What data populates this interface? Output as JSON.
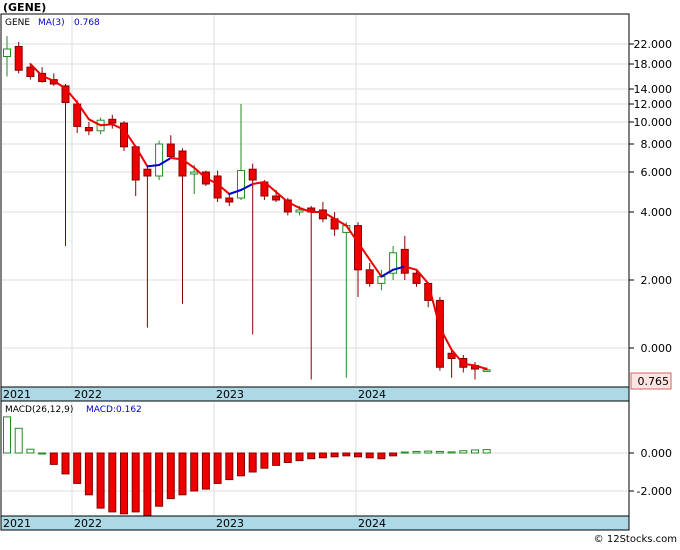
{
  "title": "(GENE)",
  "watermark": "© 12Stocks.com",
  "colors": {
    "up_fill": "#ffffff",
    "up_stroke": "#228b22",
    "down_fill": "#ee0000",
    "down_stroke": "#880000",
    "ma_down": "#ee0000",
    "ma_up": "#0000cc",
    "axis_band": "#add8e6",
    "last_price_box": "#ffe4e1",
    "macd_up": "#228b22",
    "macd_down": "#ee0000"
  },
  "chart_data": [
    {
      "type": "candlestick",
      "legend": {
        "symbol": "GENE",
        "ma_label": "MA(3)",
        "ma_value": "0.768"
      },
      "y_tick_labels": [
        "22.000",
        "18.000",
        "14.000",
        "12.000",
        "10.000",
        "8.000",
        "6.000",
        "4.000",
        "2.000",
        "0.000"
      ],
      "x_tick_labels": [
        "2021",
        "2022",
        "2023",
        "2024"
      ],
      "last_price_label": "0.765",
      "candles": [
        {
          "o": 19.5,
          "h": 24.0,
          "l": 16.0,
          "c": 21.0
        },
        {
          "o": 21.5,
          "h": 22.5,
          "l": 16.5,
          "c": 17.0
        },
        {
          "o": 17.5,
          "h": 18.0,
          "l": 15.5,
          "c": 16.0
        },
        {
          "o": 16.5,
          "h": 17.5,
          "l": 15.0,
          "c": 15.2
        },
        {
          "o": 15.5,
          "h": 16.5,
          "l": 14.5,
          "c": 14.8
        },
        {
          "o": 14.5,
          "h": 14.8,
          "l": 3.0,
          "c": 12.2
        },
        {
          "o": 12.0,
          "h": 12.5,
          "l": 9.0,
          "c": 9.6
        },
        {
          "o": 9.5,
          "h": 10.0,
          "l": 8.8,
          "c": 9.2
        },
        {
          "o": 9.2,
          "h": 10.5,
          "l": 8.9,
          "c": 10.2
        },
        {
          "o": 10.3,
          "h": 10.8,
          "l": 9.4,
          "c": 9.9
        },
        {
          "o": 9.9,
          "h": 10.1,
          "l": 7.5,
          "c": 7.8
        },
        {
          "o": 7.8,
          "h": 7.9,
          "l": 4.8,
          "c": 5.6
        },
        {
          "o": 6.2,
          "h": 6.5,
          "l": 0.6,
          "c": 5.8
        },
        {
          "o": 5.8,
          "h": 8.3,
          "l": 5.6,
          "c": 8.0
        },
        {
          "o": 8.0,
          "h": 8.8,
          "l": 7.0,
          "c": 7.1
        },
        {
          "o": 7.5,
          "h": 7.7,
          "l": 1.3,
          "c": 5.8
        },
        {
          "o": 5.9,
          "h": 6.5,
          "l": 4.9,
          "c": 6.0
        },
        {
          "o": 6.0,
          "h": 6.1,
          "l": 5.3,
          "c": 5.4
        },
        {
          "o": 5.8,
          "h": 6.1,
          "l": 4.5,
          "c": 4.7
        },
        {
          "o": 4.7,
          "h": 4.9,
          "l": 4.3,
          "c": 4.5
        },
        {
          "o": 4.7,
          "h": 12.0,
          "l": 4.6,
          "c": 6.1
        },
        {
          "o": 6.2,
          "h": 6.6,
          "l": 0.4,
          "c": 5.6
        },
        {
          "o": 5.5,
          "h": 5.6,
          "l": 4.6,
          "c": 4.8
        },
        {
          "o": 4.8,
          "h": 5.1,
          "l": 4.5,
          "c": 4.6
        },
        {
          "o": 4.6,
          "h": 4.7,
          "l": 3.9,
          "c": 4.0
        },
        {
          "o": 4.0,
          "h": 4.3,
          "l": 3.9,
          "c": 4.1
        },
        {
          "o": 4.2,
          "h": 4.3,
          "l": -1.8,
          "c": 4.0
        },
        {
          "o": 4.1,
          "h": 4.5,
          "l": 3.7,
          "c": 3.8
        },
        {
          "o": 3.8,
          "h": 4.0,
          "l": 3.3,
          "c": 3.5
        },
        {
          "o": 3.4,
          "h": 3.7,
          "l": -1.7,
          "c": 3.6
        },
        {
          "o": 3.6,
          "h": 3.7,
          "l": 1.5,
          "c": 2.3
        },
        {
          "o": 2.3,
          "h": 2.5,
          "l": 1.8,
          "c": 1.9
        },
        {
          "o": 1.9,
          "h": 2.3,
          "l": 1.7,
          "c": 2.1
        },
        {
          "o": 2.2,
          "h": 3.0,
          "l": 2.0,
          "c": 2.8
        },
        {
          "o": 2.9,
          "h": 3.3,
          "l": 2.0,
          "c": 2.2
        },
        {
          "o": 2.2,
          "h": 2.3,
          "l": 1.8,
          "c": 1.9
        },
        {
          "o": 1.9,
          "h": 1.9,
          "l": 1.2,
          "c": 1.4
        },
        {
          "o": 1.4,
          "h": 1.5,
          "l": -1.3,
          "c": -1.1
        },
        {
          "o": -0.3,
          "h": -0.1,
          "l": -1.7,
          "c": -0.6
        },
        {
          "o": -0.6,
          "h": -0.4,
          "l": -1.4,
          "c": -1.1
        },
        {
          "o": -1.0,
          "h": -0.8,
          "l": -1.8,
          "c": -1.2
        },
        {
          "o": -1.25,
          "h": -1.1,
          "l": -1.35,
          "c": -1.25
        }
      ],
      "ma": [
        null,
        null,
        18.0,
        16.1,
        15.3,
        14.1,
        12.2,
        10.3,
        9.7,
        9.8,
        9.3,
        7.8,
        6.4,
        6.5,
        7.0,
        6.9,
        6.3,
        5.7,
        5.4,
        4.9,
        5.1,
        5.4,
        5.5,
        5.0,
        4.5,
        4.2,
        4.0,
        4.0,
        3.8,
        3.6,
        3.1,
        2.6,
        2.1,
        2.3,
        2.4,
        2.3,
        1.9,
        0.6,
        -0.1,
        -0.9,
        -1.0,
        -1.2
      ],
      "ma_up": [
        false,
        false,
        false,
        false,
        false,
        false,
        false,
        false,
        false,
        false,
        false,
        false,
        false,
        true,
        true,
        false,
        false,
        false,
        false,
        false,
        true,
        true,
        false,
        false,
        false,
        false,
        false,
        false,
        false,
        false,
        false,
        false,
        false,
        true,
        true,
        false,
        false,
        false,
        false,
        false,
        false,
        false
      ]
    },
    {
      "type": "bar",
      "legend": {
        "label": "MACD(26,12,9)",
        "value_label": "MACD:0.162"
      },
      "y_tick_labels": [
        "0.000",
        "-2.000"
      ],
      "x_tick_labels": [
        "2021",
        "2022",
        "2023",
        "2024"
      ],
      "histogram": [
        1.9,
        1.3,
        0.2,
        0,
        -0.6,
        -1.1,
        -1.6,
        -2.2,
        -2.9,
        -3.1,
        -3.2,
        -3.1,
        -3.3,
        -2.8,
        -2.4,
        -2.2,
        -2.0,
        -1.9,
        -1.6,
        -1.4,
        -1.2,
        -1.0,
        -0.8,
        -0.65,
        -0.5,
        -0.4,
        -0.3,
        -0.25,
        -0.2,
        -0.15,
        -0.2,
        -0.25,
        -0.3,
        -0.15,
        0.05,
        0.08,
        0.1,
        0.08,
        0.06,
        0.12,
        0.16,
        0.18
      ]
    }
  ]
}
